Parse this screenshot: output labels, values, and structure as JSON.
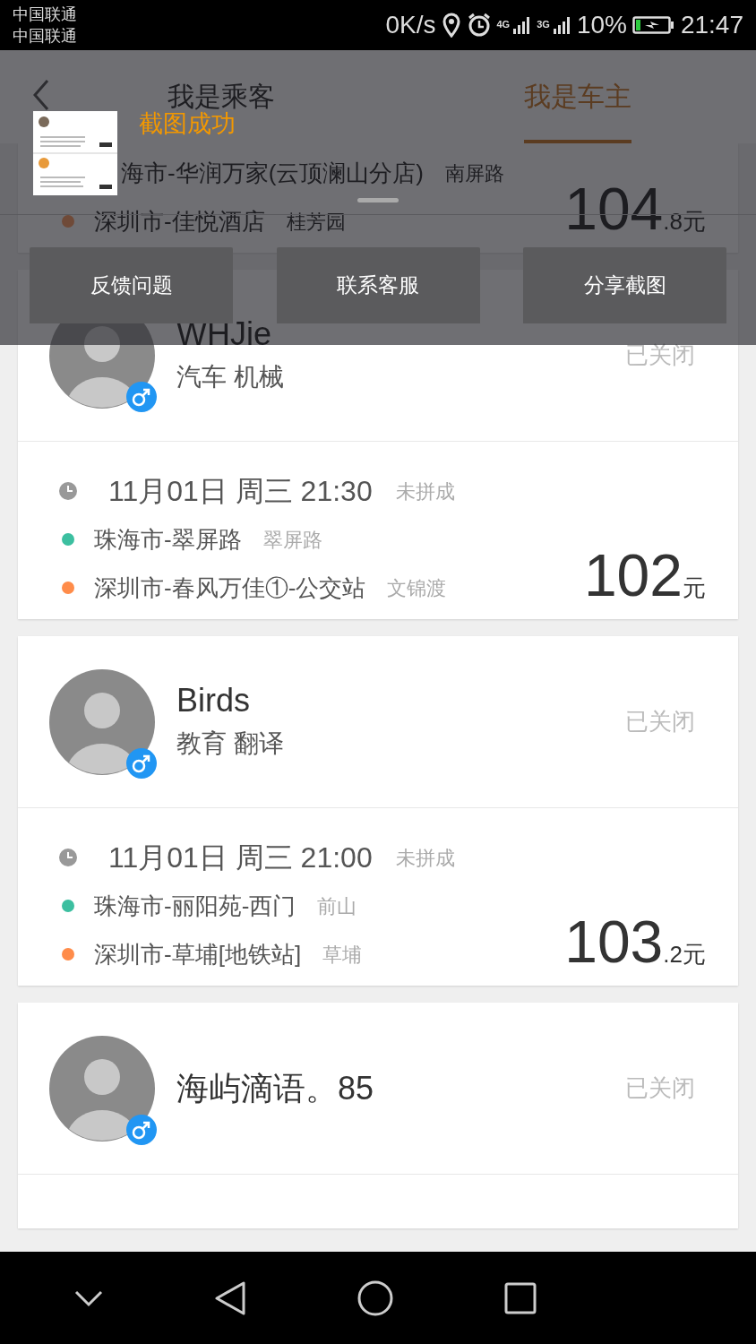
{
  "status_bar": {
    "carriers": [
      "中国联通",
      "中国联通"
    ],
    "speed": "0K/s",
    "network_types": [
      "4G",
      "3G"
    ],
    "battery": "10%",
    "time": "21:47"
  },
  "header": {
    "tabs": [
      {
        "label": "我是乘客",
        "selected": false
      },
      {
        "label": "我是车主",
        "selected": true
      }
    ]
  },
  "orders": [
    {
      "trip": {
        "routes": [
          {
            "place": "海市-华润万家(云顶澜山分店)",
            "area": "南屏路"
          },
          {
            "kind": "end",
            "place": "深圳市-佳悦酒店",
            "area": "桂芳园"
          }
        ],
        "price": {
          "amount": "104",
          "suffix": ".8元"
        }
      }
    },
    {
      "user": {
        "name": "WHJie",
        "tags": "汽车 机械",
        "male": true,
        "status": "已关闭"
      },
      "trip": {
        "time": "11月01日 周三 21:30",
        "state": "未拼成",
        "routes": [
          {
            "kind": "start",
            "place": "珠海市-翠屏路",
            "area": "翠屏路"
          },
          {
            "kind": "end",
            "place": "深圳市-春风万佳①-公交站",
            "area": "文锦渡"
          }
        ],
        "price": {
          "amount": "102",
          "suffix": "元"
        }
      }
    },
    {
      "user": {
        "name": "Birds",
        "tags": "教育 翻译",
        "male": true,
        "status": "已关闭"
      },
      "trip": {
        "time": "11月01日 周三 21:00",
        "state": "未拼成",
        "routes": [
          {
            "kind": "start",
            "place": "珠海市-丽阳苑-西门",
            "area": "前山"
          },
          {
            "kind": "end",
            "place": "深圳市-草埔[地铁站]",
            "area": "草埔"
          }
        ],
        "price": {
          "amount": "103",
          "suffix": ".2元"
        }
      }
    },
    {
      "user": {
        "name": "海屿滴语。85",
        "male": true,
        "status": "已关闭"
      }
    }
  ],
  "screenshot_popup": {
    "title": "截图成功",
    "buttons": [
      "反馈问题",
      "联系客服",
      "分享截图"
    ]
  }
}
